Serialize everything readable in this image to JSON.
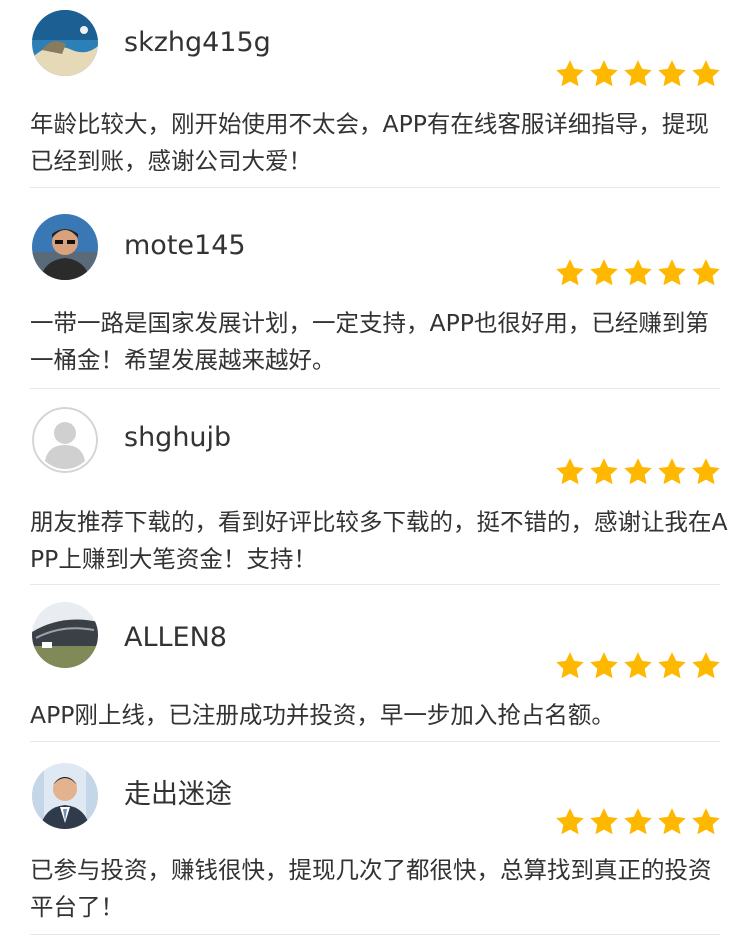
{
  "colors": {
    "star": "#FFB800",
    "text": "#333333",
    "divider": "#E8E8E8"
  },
  "reviews": [
    {
      "avatar_icon": "landscape-avatar-icon",
      "username": "skzhg415g",
      "rating": 5,
      "comment": "年龄比较大，刚开始使用不太会，APP有在线客服详细指导，提现已经到账，感谢公司大爱！"
    },
    {
      "avatar_icon": "man-sunglasses-avatar-icon",
      "username": "mote145",
      "rating": 5,
      "comment": "一带一路是国家发展计划，一定支持，APP也很好用，已经赚到第一桶金！希望发展越来越好。"
    },
    {
      "avatar_icon": "default-user-avatar-icon",
      "username": "shghujb",
      "rating": 5,
      "comment": "朋友推荐下载的，看到好评比较多下载的，挺不错的，感谢让我在APP上赚到大笔资金！支持！"
    },
    {
      "avatar_icon": "building-avatar-icon",
      "username": "ALLEN8",
      "rating": 5,
      "comment": "APP刚上线，已注册成功并投资，早一步加入抢占名额。"
    },
    {
      "avatar_icon": "businessman-avatar-icon",
      "username": "走出迷途",
      "rating": 5,
      "comment": "已参与投资，赚钱很快，提现几次了都很快，总算找到真正的投资平台了！"
    }
  ]
}
